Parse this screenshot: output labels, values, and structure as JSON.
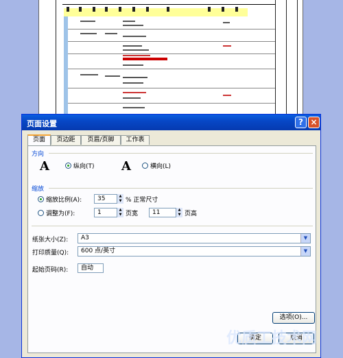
{
  "dialog": {
    "title": "页面设置",
    "help_label": "?",
    "close_label": "×",
    "tabs": [
      {
        "label": "页面",
        "active": true
      },
      {
        "label": "页边距",
        "active": false
      },
      {
        "label": "页眉/页脚",
        "active": false
      },
      {
        "label": "工作表",
        "active": false
      }
    ],
    "orientation": {
      "group_label": "方向",
      "icon_letter": "A",
      "portrait_label": "纵向(T)",
      "landscape_label": "横向(L)",
      "selected": "portrait"
    },
    "scaling": {
      "group_label": "缩放",
      "adjust_label": "缩放比例(A):",
      "adjust_value": "35",
      "adjust_suffix": "% 正常尺寸",
      "fit_label": "调整为(F):",
      "fit_wide_value": "1",
      "fit_wide_suffix": "页宽",
      "fit_tall_value": "11",
      "fit_tall_suffix": "页高",
      "selected": "adjust"
    },
    "paper_size": {
      "label": "纸张大小(Z):",
      "value": "A3"
    },
    "print_quality": {
      "label": "打印质量(Q):",
      "value": "600 点/英寸"
    },
    "first_page": {
      "label": "起始页码(R):",
      "value": "自动"
    },
    "options_label": "选项(O)...",
    "ok_label": "确定",
    "cancel_label": "取消"
  },
  "watermark_text": "优质工技术网",
  "colors": {
    "title_bar": "#0747c6",
    "dialog_bg": "#ece9d8",
    "header_band": "#ffff99",
    "highlight_bar": "#cc0000"
  }
}
